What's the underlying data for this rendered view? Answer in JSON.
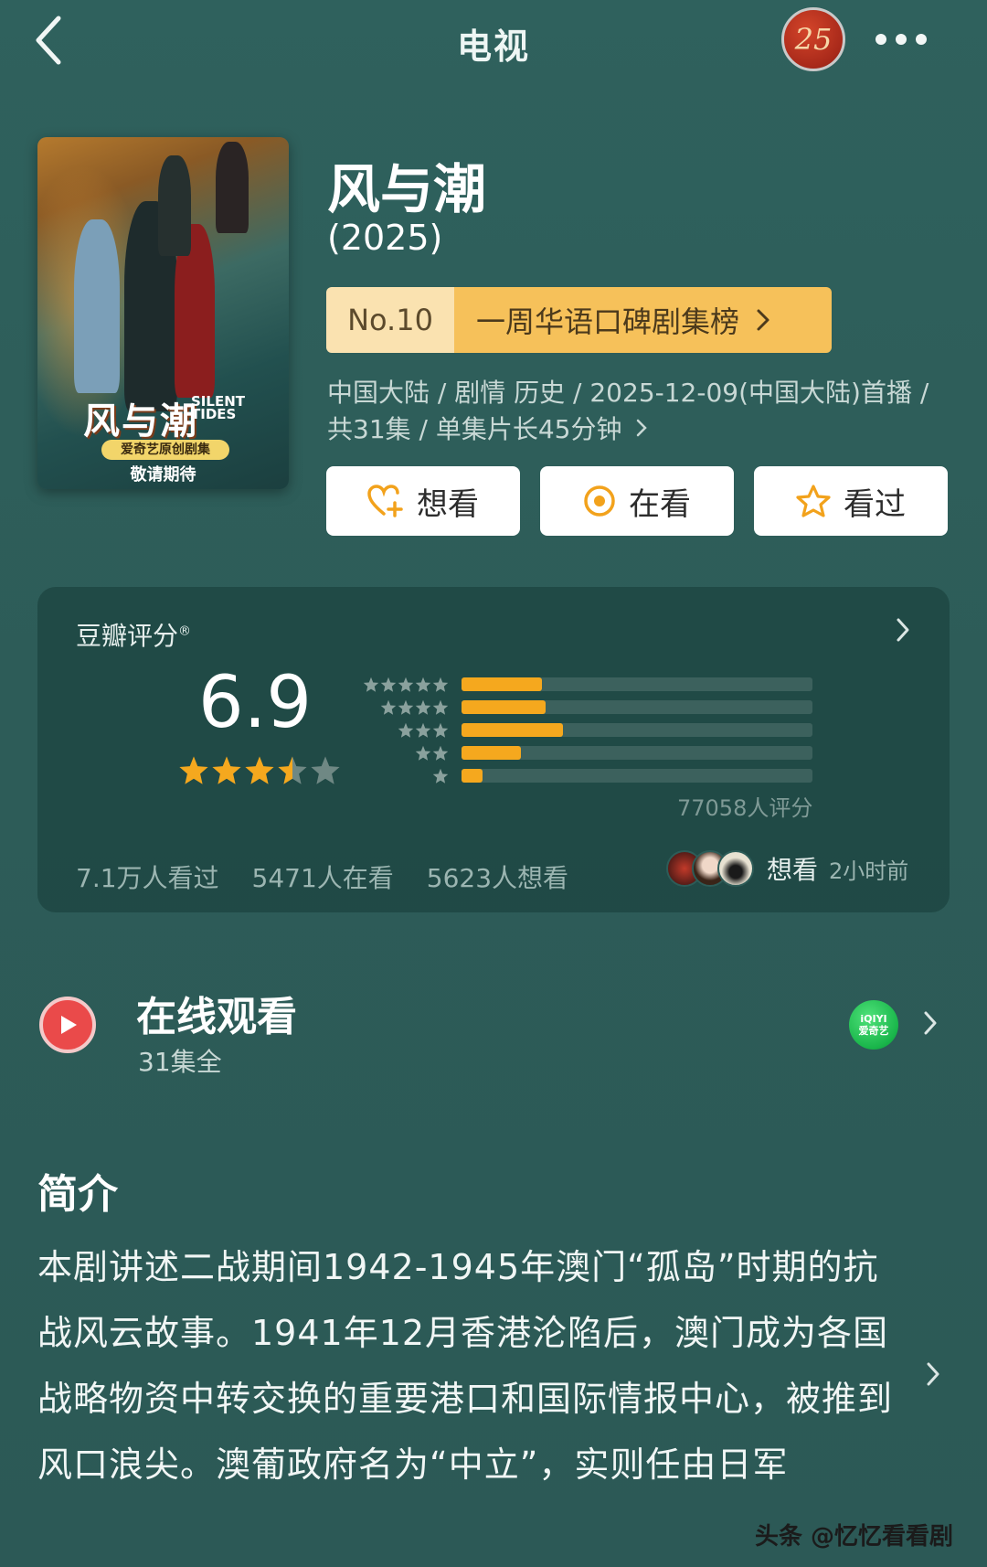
{
  "header": {
    "title": "电视",
    "badge_text": "25",
    "more_icon": "more-dots-icon",
    "back_icon": "chevron-left-icon"
  },
  "poster": {
    "title": "风与潮",
    "title_en": "SILENT TIDES",
    "tag": "爱奇艺原创剧集",
    "subtitle": "敬请期待"
  },
  "show": {
    "title": "风与潮",
    "year": "(2025)",
    "rank_no": "No.10",
    "rank_name": "一周华语口碑剧集榜",
    "meta": "中国大陆 / 剧情 历史 / 2025-12-09(中国大陆)首播 / 共31集 / 单集片长45分钟"
  },
  "actions": [
    {
      "label": "想看",
      "icon": "heart-plus-icon"
    },
    {
      "label": "在看",
      "icon": "target-circle-icon"
    },
    {
      "label": "看过",
      "icon": "star-outline-icon"
    }
  ],
  "rating": {
    "label": "豆瓣评分",
    "reg_mark": "®",
    "score": "6.9",
    "stars": 3.5,
    "distribution": [
      {
        "stars": 5,
        "fraction": 0.23
      },
      {
        "stars": 4,
        "fraction": 0.24
      },
      {
        "stars": 3,
        "fraction": 0.29
      },
      {
        "stars": 2,
        "fraction": 0.17
      },
      {
        "stars": 1,
        "fraction": 0.06
      }
    ],
    "count": "77058人评分",
    "watched": "7.1万人看过",
    "watching": "5471人在看",
    "want": "5623人想看",
    "friend_action": "想看",
    "friend_time": "2小时前"
  },
  "watch": {
    "title": "在线观看",
    "subtitle": "31集全",
    "platform_line1": "iQIYI",
    "platform_line2": "爱奇艺"
  },
  "intro": {
    "title": "简介",
    "text": "本剧讲述二战期间1942-1945年澳门“孤岛”时期的抗战风云故事。1941年12月香港沦陷后，澳门成为各国战略物资中转交换的重要港口和国际情报中心，被推到风口浪尖。澳葡政府名为“中立”，实则任由日军"
  },
  "watermark": "头条 @忆忆看看剧",
  "colors": {
    "accent": "#f5a81e",
    "rank_left": "#fae2b0",
    "rank_right": "#f6c15a",
    "play": "#ea4a4a",
    "iqiyi": "#19b54a"
  }
}
